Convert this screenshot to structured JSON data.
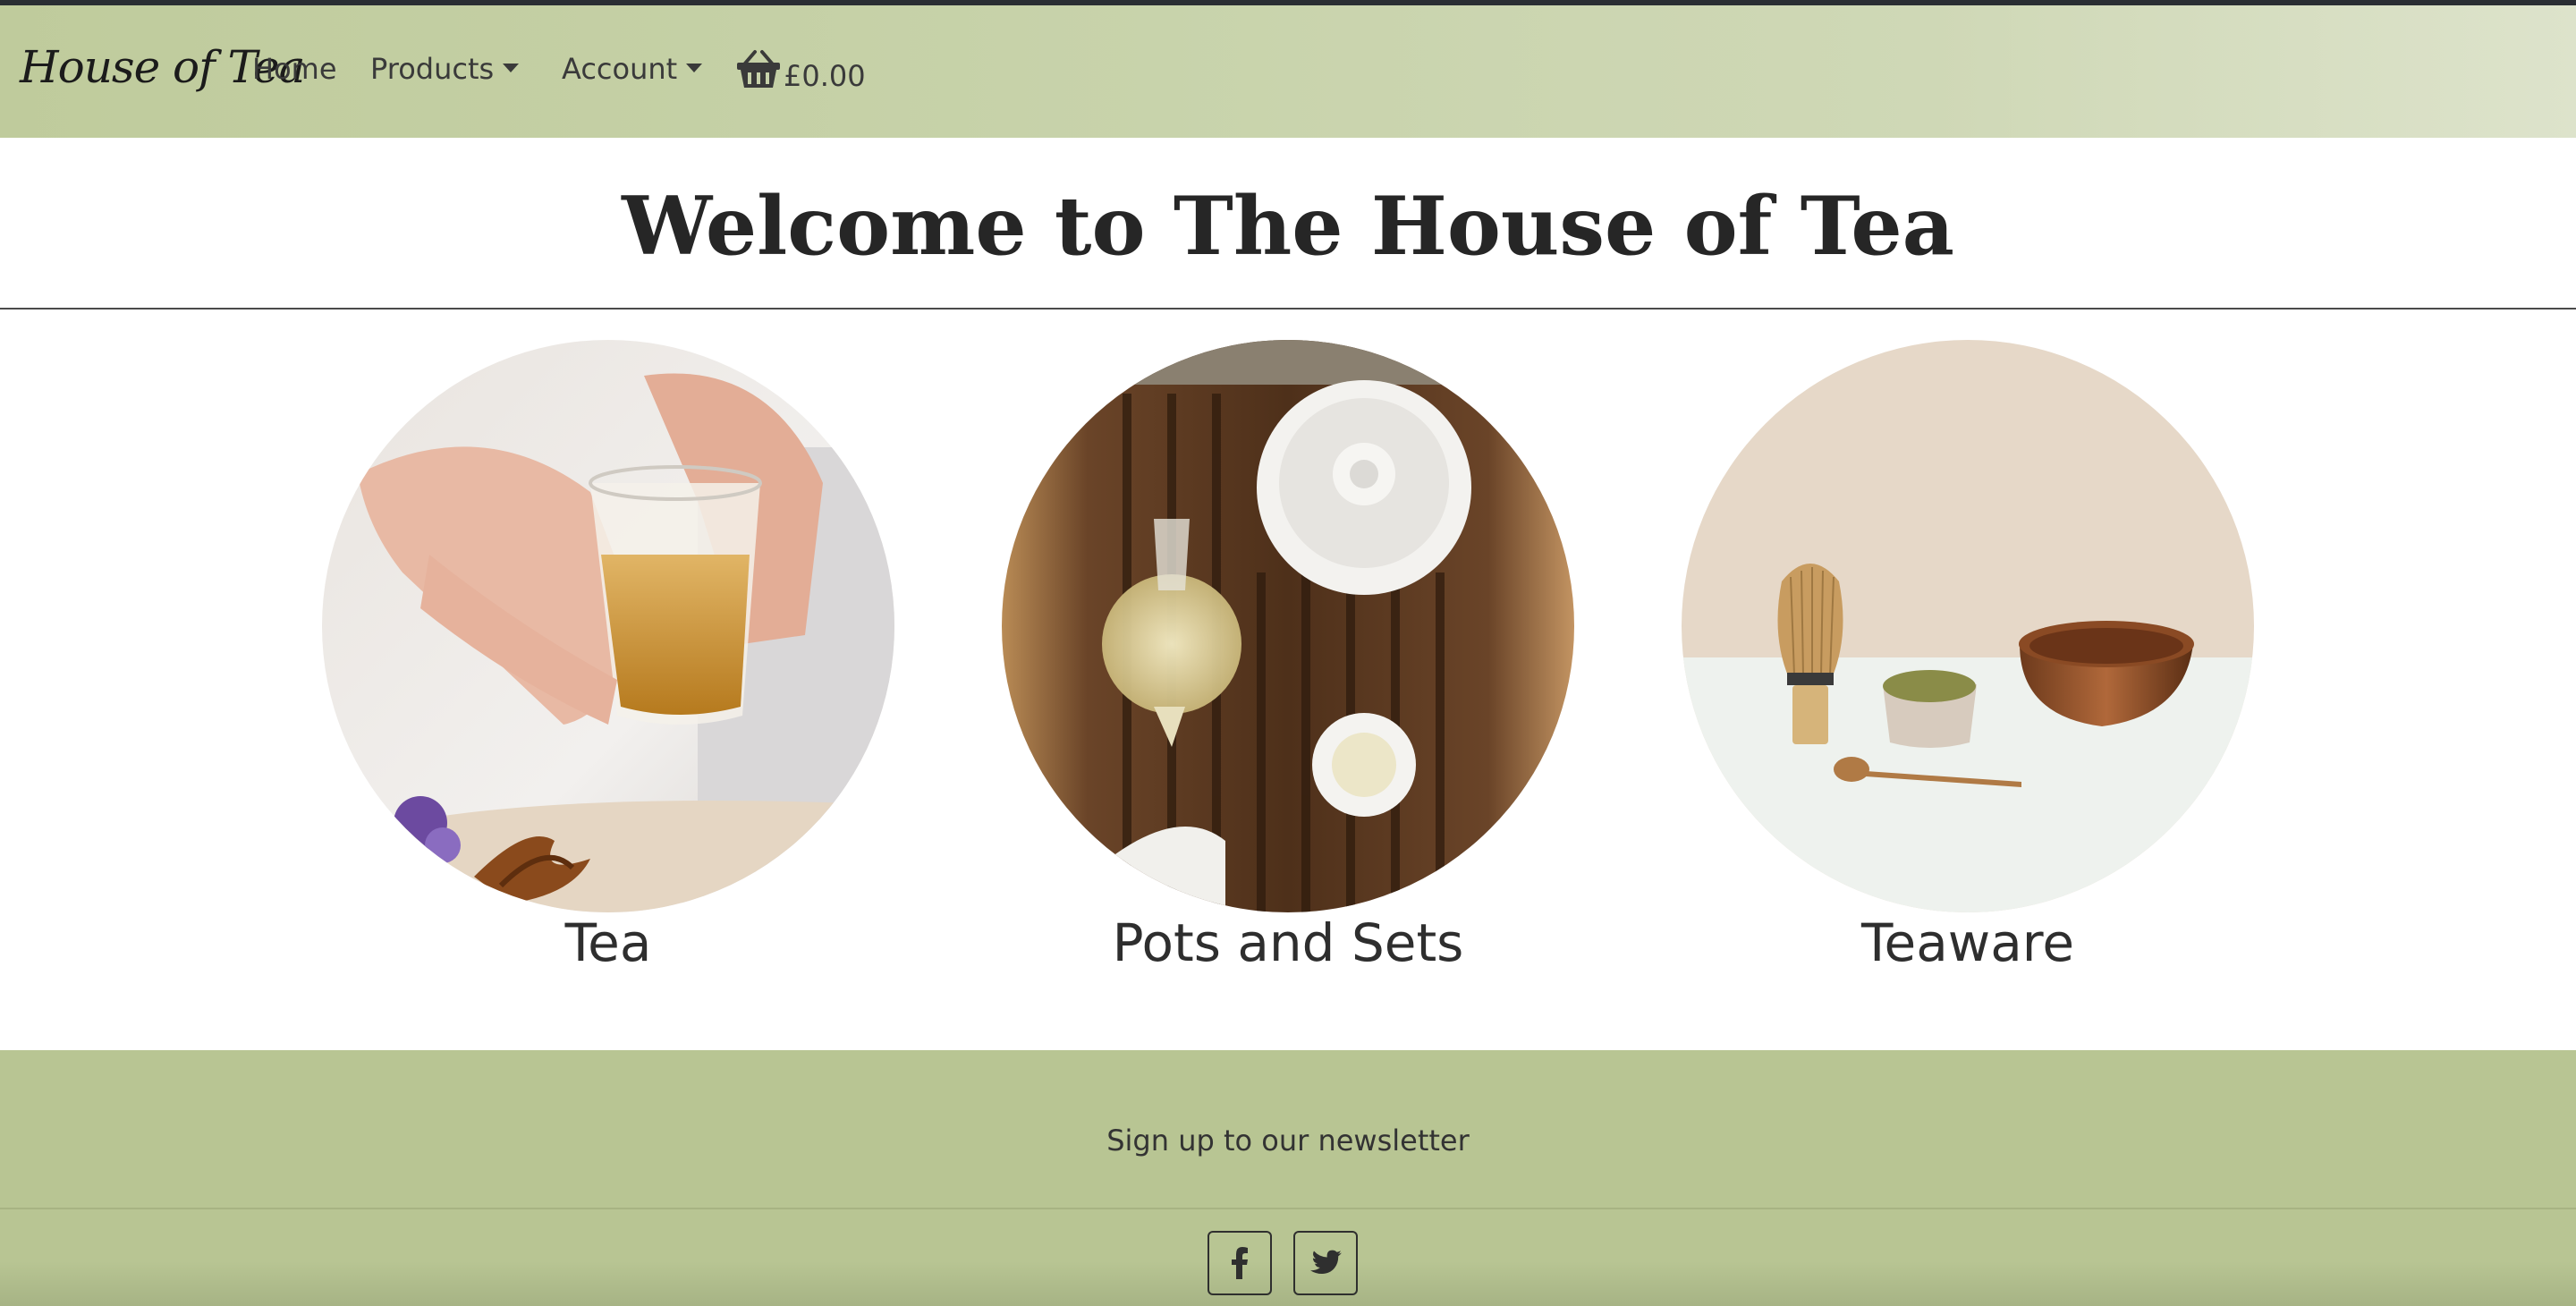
{
  "navbar": {
    "brand": "House of Tea",
    "home_label": "Home",
    "products_label": "Products",
    "account_label": "Account",
    "cart_total": "£0.00",
    "cart_icon": "basket-icon"
  },
  "page": {
    "title": "Welcome to The House of Tea"
  },
  "categories": [
    {
      "label": "Tea"
    },
    {
      "label": "Pots and Sets"
    },
    {
      "label": "Teaware"
    }
  ],
  "footer": {
    "newsletter_text": "Sign up to our newsletter",
    "social_icons": [
      "facebook-icon",
      "twitter-icon"
    ]
  },
  "colors": {
    "nav_bg": "#c8d3ab",
    "footer_bg": "#b8c593",
    "text": "#2f2f2f"
  }
}
